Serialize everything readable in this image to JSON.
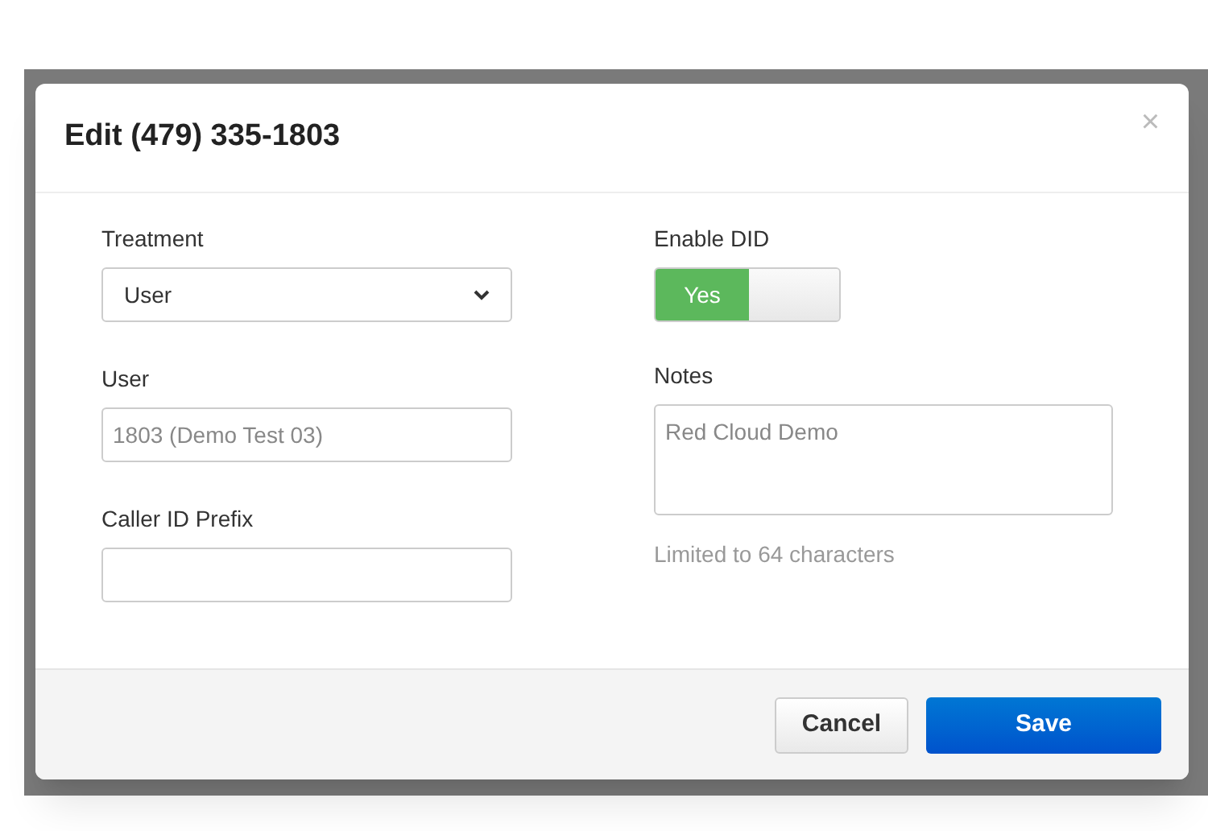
{
  "dialog": {
    "title": "Edit (479) 335-1803",
    "close": "×"
  },
  "left_fields": [
    {
      "kind": "select",
      "label": "Treatment",
      "value": "User"
    },
    {
      "kind": "readonly",
      "label": "User",
      "value": "1803 (Demo Test 03)"
    },
    {
      "kind": "text",
      "label": "Caller ID Prefix"
    }
  ],
  "enable_did": {
    "label": "Enable DID",
    "on": true,
    "on_text": "Yes"
  },
  "notes": {
    "label": "Notes",
    "value": "Red Cloud Demo",
    "help": "Limited to 64 characters"
  },
  "buttons": [
    {
      "kind": "secondary",
      "label": "Cancel"
    },
    {
      "kind": "primary",
      "label": "Save"
    }
  ]
}
